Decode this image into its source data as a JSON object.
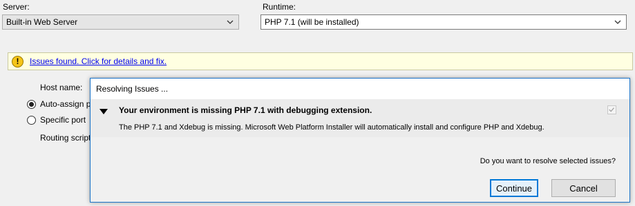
{
  "server": {
    "label": "Server:",
    "value": "Built-in Web Server"
  },
  "runtime": {
    "label": "Runtime:",
    "value": "PHP 7.1 (will be installed)"
  },
  "issues_bar": {
    "icon": "warning-icon",
    "link_text": "Issues found. Click for details and fix."
  },
  "host": {
    "host_label": "Host name:",
    "auto_assign_label": "Auto-assign p",
    "specific_port_label": "Specific port",
    "routing_label": "Routing script",
    "auto_assign_selected": true
  },
  "dialog": {
    "title": "Resolving Issues ...",
    "issue_title": "Your environment is missing PHP 7.1 with debugging extension.",
    "issue_desc": "The PHP 7.1 and Xdebug is missing. Microsoft Web Platform Installer will automatically install and configure PHP and Xdebug.",
    "question": "Do you want to resolve selected issues?",
    "continue_label": "Continue",
    "cancel_label": "Cancel"
  },
  "colors": {
    "accent": "#0078d7",
    "info_bar": "#ffffe1",
    "link": "#0000ee"
  }
}
